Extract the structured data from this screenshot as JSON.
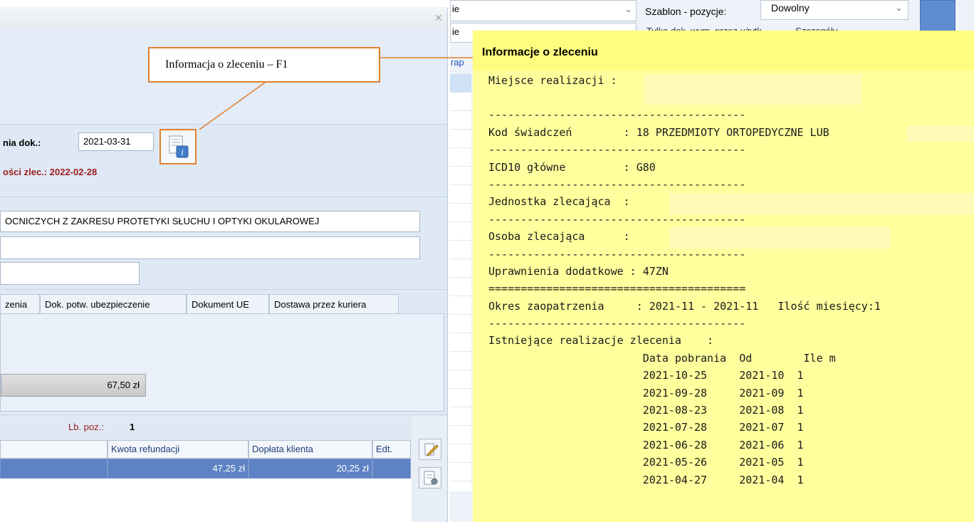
{
  "dialog": {
    "close_glyph": "×",
    "doc_date_label": "nia dok.:",
    "doc_date_value": "2021-03-31",
    "validity_label": "ości zlec.: 2022-02-28",
    "service_name": "OCNICZYCH Z ZAKRESU PROTETYKI SŁUCHU I OPTYKI OKULAROWEJ",
    "tabs": [
      "zenia",
      "Dok. potw. ubezpieczenie",
      "Dokument UE",
      "Dostawa przez kuriera"
    ],
    "total_amount": "67,50 zł",
    "positions_label": "Lb. poz.:",
    "positions_count": "1",
    "grid_headers": [
      "Kwota refundacji",
      "Dopłata klienta",
      "Edt."
    ],
    "grid_row": [
      "47,25 zł",
      "20,25 zł",
      ""
    ],
    "info_icon": "document-info-icon",
    "edit_icon": "pencil-edit-icon",
    "settings_icon": "document-settings-icon"
  },
  "background_window": {
    "top_field1_fragment": "ie",
    "top_field2_fragment": "ie",
    "template_label": "Szablon - pozycje:",
    "template_value": "Dowolny",
    "obscured_checkbox1": "Tylko dok. wym. przez użytk.",
    "obscured_checkbox2": "Szczegóły",
    "link_fragment": "rap"
  },
  "callout": {
    "text": "Informacja o zleceniu – F1",
    "accent": "#e0802e"
  },
  "popup": {
    "title": "Informacje o zleceniu",
    "lines": [
      "Miejsce realizacji :",
      "",
      "----------------------------------------",
      "Kod świadczeń        : 18 PRZEDMIOTY ORTOPEDYCZNE LUB",
      "----------------------------------------",
      "ICD10 główne         : G80",
      "----------------------------------------",
      "Jednostka zlecająca  :",
      "----------------------------------------",
      "Osoba zlecająca      :",
      "----------------------------------------",
      "Uprawnienia dodatkowe : 47ZN",
      "========================================",
      "Okres zaopatrzenia     : 2021-11 - 2021-11   Ilość miesięcy:1",
      "----------------------------------------",
      "Istniejące realizacje zlecenia    :",
      "                        Data pobrania  Od        Ile m",
      "                        2021-10-25     2021-10  1",
      "                        2021-09-28     2021-09  1",
      "                        2021-08-23     2021-08  1",
      "                        2021-07-28     2021-07  1",
      "                        2021-06-28     2021-06  1",
      "                        2021-05-26     2021-05  1",
      "                        2021-04-27     2021-04  1"
    ],
    "background": "#ffff9e"
  }
}
